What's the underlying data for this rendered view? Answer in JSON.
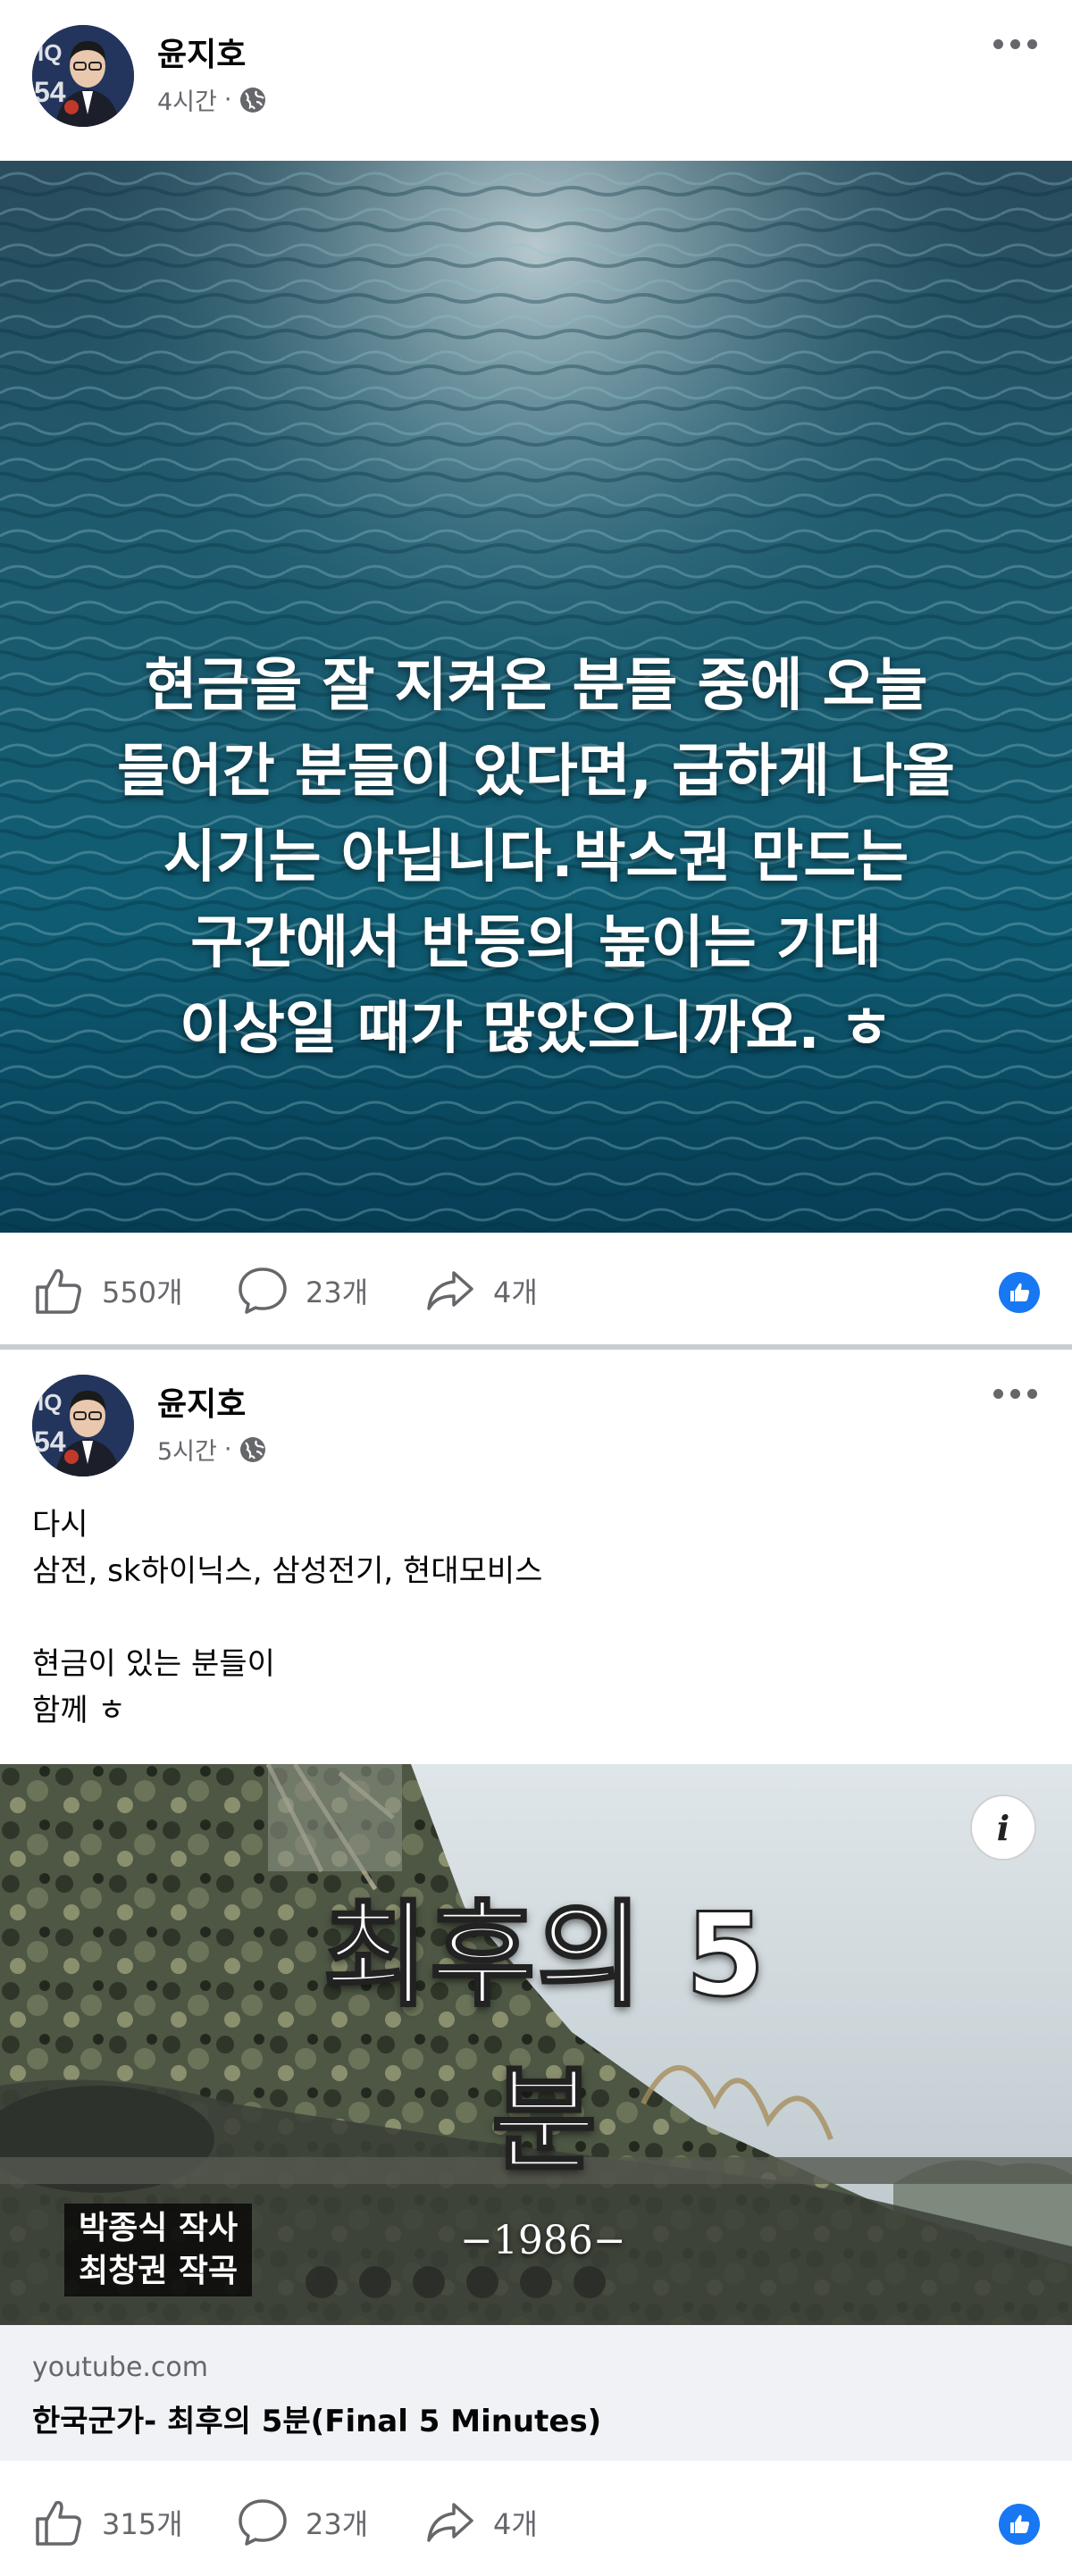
{
  "posts": [
    {
      "author": "윤지호",
      "time": "4시간",
      "separator": "·",
      "image_text": "현금을 잘 지켜온 분들 중에 오늘\n들어간 분들이 있다면, 급하게 나올\n시기는 아닙니다.박스권 만드는\n구간에서 반등의 높이는 기대\n이상일 때가 많았으니까요. ㅎ",
      "likes": "550개",
      "comments": "23개",
      "shares": "4개"
    },
    {
      "author": "윤지호",
      "time": "5시간",
      "separator": "·",
      "body": "다시\n삼전, sk하이닉스, 삼성전기, 현대모비스\n\n현금이 있는 분들이\n함께 ㅎ",
      "video": {
        "title": "최후의 5분",
        "credit": "박종식 작사\n최창권 작곡",
        "year": "−1986−",
        "info": "i"
      },
      "link": {
        "domain": "youtube.com",
        "title": "한국군가- 최후의 5분(Final 5 Minutes)"
      },
      "likes": "315개",
      "comments": "23개",
      "shares": "4개"
    }
  ],
  "colors": {
    "accent": "#1877f2",
    "secondary_text": "#65676b",
    "link_box_bg": "#f0f2f5",
    "separator": "#c9ccd1"
  },
  "icons": [
    "globe-icon",
    "more-icon",
    "like-icon",
    "comment-icon",
    "share-icon",
    "reaction-like-icon",
    "info-icon"
  ]
}
